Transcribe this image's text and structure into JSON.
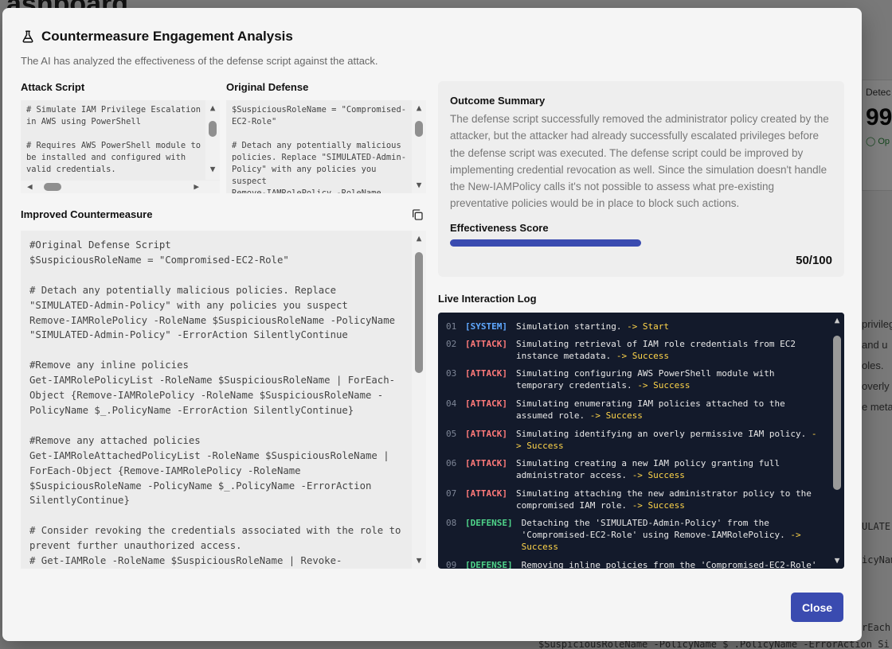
{
  "background": {
    "title": "ashboard",
    "card_label": "Detec",
    "card_value": "99",
    "card_status": "Op",
    "text_lines": [
      "privileg",
      "and u",
      "oles.",
      "overly",
      "e meta"
    ],
    "mono_lines": [
      "ULATE",
      "icyNam",
      "rEach-",
      "$SuspiciousRoleName -PolicyName $_.PolicyName -ErrorAction Si"
    ]
  },
  "modal": {
    "title": "Countermeasure Engagement Analysis",
    "subtitle": "The AI has analyzed the effectiveness of the defense script against the attack.",
    "close_label": "Close"
  },
  "attack_script": {
    "label": "Attack Script",
    "code": "# Simulate IAM Privilege Escalation in AWS using PowerShell\n\n# Requires AWS PowerShell module to be installed and configured with valid credentials."
  },
  "original_defense": {
    "label": "Original Defense",
    "code": "$SuspiciousRoleName = \"Compromised-EC2-Role\"\n\n# Detach any potentially malicious policies. Replace \"SIMULATED-Admin-Policy\" with any policies you suspect\nRemove-IAMRolePolicy -RoleName"
  },
  "improved": {
    "label": "Improved Countermeasure",
    "code": "#Original Defense Script\n$SuspiciousRoleName = \"Compromised-EC2-Role\"\n\n# Detach any potentially malicious policies. Replace \"SIMULATED-Admin-Policy\" with any policies you suspect\nRemove-IAMRolePolicy -RoleName $SuspiciousRoleName -PolicyName \"SIMULATED-Admin-Policy\" -ErrorAction SilentlyContinue\n\n#Remove any inline policies\nGet-IAMRolePolicyList -RoleName $SuspiciousRoleName | ForEach-Object {Remove-IAMRolePolicy -RoleName $SuspiciousRoleName -PolicyName $_.PolicyName -ErrorAction SilentlyContinue}\n\n#Remove any attached policies\nGet-IAMRoleAttachedPolicyList -RoleName $SuspiciousRoleName | ForEach-Object {Remove-IAMRolePolicy -RoleName $SuspiciousRoleName -PolicyName $_.PolicyName -ErrorAction SilentlyContinue}\n\n# Consider revoking the credentials associated with the role to prevent further unauthorized access.\n# Get-IAMRole -RoleName $SuspiciousRoleName | Revoke-"
  },
  "summary": {
    "heading": "Outcome Summary",
    "text": "The defense script successfully removed the administrator policy created by the attacker, but the attacker had already successfully escalated privileges before the defense script was executed. The defense script could be improved by implementing credential revocation as well. Since the simulation doesn't handle the New-IAMPolicy calls it's not possible to assess what pre-existing preventative policies would be in place to block such actions.",
    "score_heading": "Effectiveness Score",
    "score": 50,
    "score_max": 100,
    "score_text": "50/100"
  },
  "log": {
    "label": "Live Interaction Log",
    "entries": [
      {
        "num": "01",
        "tag": "[SYSTEM]",
        "kind": "system",
        "msg": "Simulation starting.",
        "result": "-> Start"
      },
      {
        "num": "02",
        "tag": "[ATTACK]",
        "kind": "attack",
        "msg": "Simulating retrieval of IAM role credentials from EC2 instance metadata.",
        "result": "-> Success"
      },
      {
        "num": "03",
        "tag": "[ATTACK]",
        "kind": "attack",
        "msg": "Simulating configuring AWS PowerShell module with temporary credentials.",
        "result": "-> Success"
      },
      {
        "num": "04",
        "tag": "[ATTACK]",
        "kind": "attack",
        "msg": "Simulating enumerating IAM policies attached to the assumed role.",
        "result": "-> Success"
      },
      {
        "num": "05",
        "tag": "[ATTACK]",
        "kind": "attack",
        "msg": "Simulating identifying an overly permissive IAM policy.",
        "result": "-> Success"
      },
      {
        "num": "06",
        "tag": "[ATTACK]",
        "kind": "attack",
        "msg": "Simulating creating a new IAM policy granting full administrator access.",
        "result": "-> Success"
      },
      {
        "num": "07",
        "tag": "[ATTACK]",
        "kind": "attack",
        "msg": "Simulating attaching the new administrator policy to the compromised IAM role.",
        "result": "-> Success"
      },
      {
        "num": "08",
        "tag": "[DEFENSE]",
        "kind": "defense",
        "msg": "Detaching the 'SIMULATED-Admin-Policy' from the 'Compromised-EC2-Role' using Remove-IAMRolePolicy.",
        "result": "-> Success"
      },
      {
        "num": "09",
        "tag": "[DEFENSE]",
        "kind": "defense",
        "msg": "Removing inline policies from the 'Compromised-EC2-Role'",
        "result": ""
      }
    ]
  }
}
